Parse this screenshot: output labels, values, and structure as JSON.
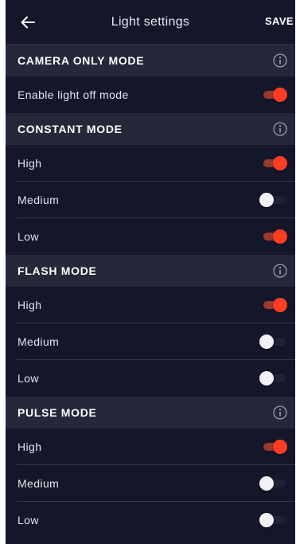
{
  "header": {
    "title": "Light settings",
    "save_label": "SAVE",
    "back_icon": "arrow-left-icon"
  },
  "colors": {
    "background": "#14172a",
    "section_header_bg": "#252839",
    "toggle_on": "#ff3d22",
    "toggle_off_knob": "#f2f2f4"
  },
  "sections": [
    {
      "title": "CAMERA ONLY MODE",
      "info_icon": "info-icon",
      "rows": [
        {
          "label": "Enable light off mode",
          "enabled": true
        }
      ]
    },
    {
      "title": "CONSTANT MODE",
      "info_icon": "info-icon",
      "rows": [
        {
          "label": "High",
          "enabled": true
        },
        {
          "label": "Medium",
          "enabled": false
        },
        {
          "label": "Low",
          "enabled": true
        }
      ]
    },
    {
      "title": "FLASH MODE",
      "info_icon": "info-icon",
      "rows": [
        {
          "label": "High",
          "enabled": true
        },
        {
          "label": "Medium",
          "enabled": false
        },
        {
          "label": "Low",
          "enabled": false
        }
      ]
    },
    {
      "title": "PULSE MODE",
      "info_icon": "info-icon",
      "rows": [
        {
          "label": "High",
          "enabled": true
        },
        {
          "label": "Medium",
          "enabled": false
        },
        {
          "label": "Low",
          "enabled": false
        }
      ]
    }
  ]
}
